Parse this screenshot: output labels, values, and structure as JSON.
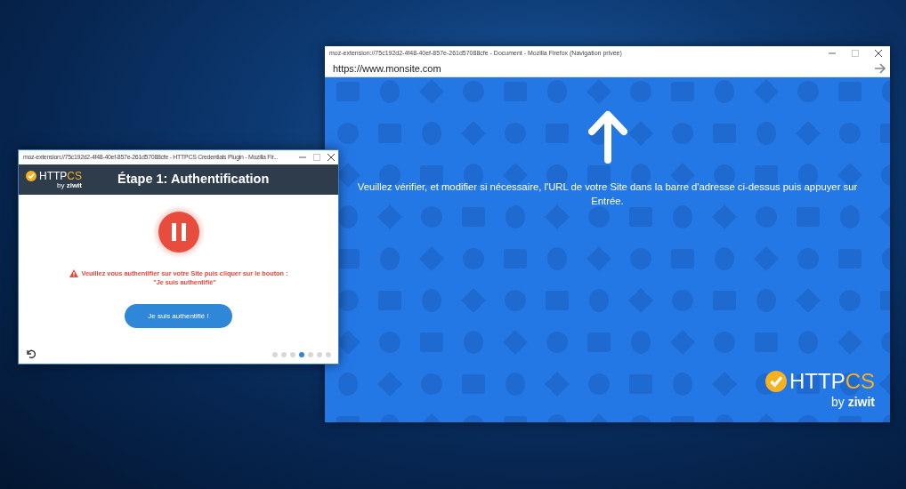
{
  "browser_window": {
    "title": "moz-extension://75c192d2-4f48-40ef-857e-261d57088cfe - Document - Mozilla Firefox (Navigation privée)",
    "url": "https://www.monsite.com",
    "instruction": "Veuillez vérifier, et modifier si nécessaire, l'URL de votre Site dans la barre d'adresse ci-dessus puis appuyer sur Entrée.",
    "logo": {
      "brand_main": "HTTP",
      "brand_accent": "CS",
      "byline": "by",
      "company": "ziwit"
    }
  },
  "extension_window": {
    "title": "moz-extension://75c192d2-4f48-40ef-857e-261d57088cfe - HTTPCS Credentials Plugin - Mozilla Fir...",
    "logo": {
      "brand_main": "HTTP",
      "brand_accent": "CS",
      "byline": "by",
      "company": "ziwit"
    },
    "heading": "Étape 1: Authentification",
    "message_lines": [
      "Veuillez vous authentifier sur votre Site puis cliquer sur le bouton :",
      "\"Je suis authentifié\""
    ],
    "button": "Je suis authentifié !",
    "steps": [
      {
        "selected": false
      },
      {
        "selected": false
      },
      {
        "selected": false
      },
      {
        "selected": true
      },
      {
        "selected": false
      },
      {
        "selected": false
      },
      {
        "selected": false
      }
    ]
  }
}
